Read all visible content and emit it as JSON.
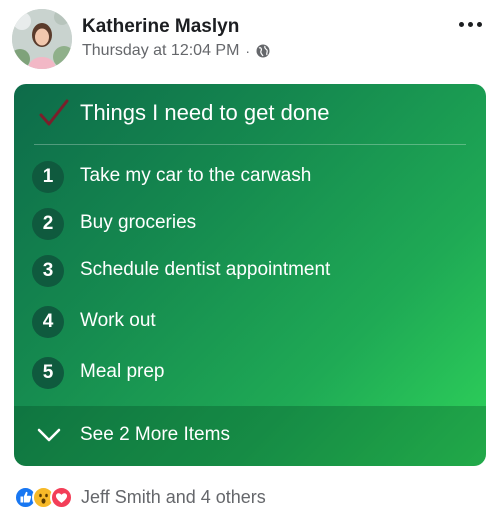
{
  "post": {
    "author": "Katherine Maslyn",
    "timestamp": "Thursday at 12:04 PM",
    "separator": "·",
    "audience_icon": "globe-icon",
    "menu_icon": "more-horizontal-icon"
  },
  "checklist": {
    "title_icon": "checkmark-icon",
    "title": "Things I need to get done",
    "items": [
      {
        "number": "1",
        "text": "Take my car to the carwash"
      },
      {
        "number": "2",
        "text": "Buy groceries"
      },
      {
        "number": "3",
        "text": "Schedule dentist appointment"
      },
      {
        "number": "4",
        "text": "Work out"
      },
      {
        "number": "5",
        "text": "Meal prep"
      }
    ],
    "see_more_icon": "chevron-down-icon",
    "see_more_label": "See 2 More Items",
    "colors": {
      "gradient_start": "#0d6b4a",
      "gradient_end": "#2fd45a",
      "number_bg": "#0f5a3e",
      "check": "#7a1f2b"
    }
  },
  "reactions": {
    "icons": [
      "like-icon",
      "wow-icon",
      "love-icon"
    ],
    "summary": "Jeff Smith and 4 others",
    "colors": {
      "like": "#1877f2",
      "wow": "#f7b928",
      "love": "#f33e58"
    }
  }
}
